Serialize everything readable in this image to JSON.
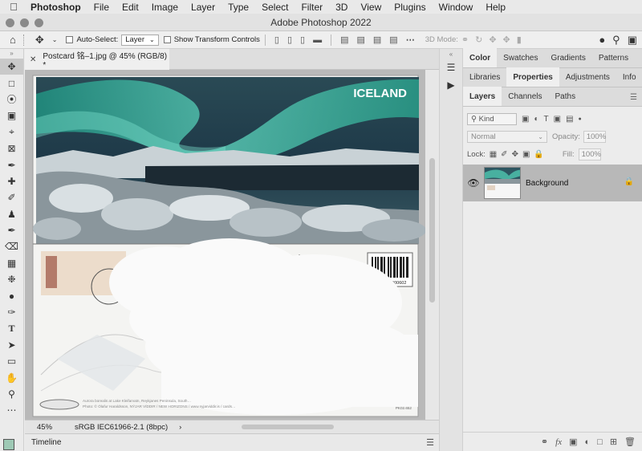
{
  "menubar": {
    "app": "Photoshop",
    "items": [
      "File",
      "Edit",
      "Image",
      "Layer",
      "Type",
      "Select",
      "Filter",
      "3D",
      "View",
      "Plugins",
      "Window",
      "Help"
    ]
  },
  "window": {
    "title": "Adobe Photoshop 2022"
  },
  "options": {
    "auto_select": "Auto-Select:",
    "layer_select": "Layer",
    "show_transform": "Show Transform Controls",
    "mode_3d": "3D Mode:"
  },
  "document": {
    "tab_title": "Postcard 铭–1.jpg @ 45% (RGB/8) *",
    "image_title": "ICELAND",
    "barcode_number": "5 690741 000602",
    "caption": "Aurora borealis at Lake Kleifarvatn, Reykjanes Peninsula, South…",
    "photo_credit": "Photo: © Ólafur Haraldsson, NÝJAR VÍDDIR / NEW HORIZONS / www.nyjarviddir.is / cards…",
    "code": "PK02.652"
  },
  "status": {
    "zoom": "45%",
    "profile": "sRGB IEC61966-2.1 (8bpc)",
    "arrow": "›"
  },
  "timeline": {
    "title": "Timeline"
  },
  "panels": {
    "row1_tabs": [
      "Color",
      "Swatches",
      "Gradients",
      "Patterns"
    ],
    "row2_tabs": [
      "Libraries",
      "Properties",
      "Adjustments",
      "Info"
    ],
    "row3_tabs": [
      "Layers",
      "Channels",
      "Paths"
    ],
    "kind": "Kind",
    "blend_mode": "Normal",
    "opacity_label": "Opacity:",
    "opacity_value": "100%",
    "lock_label": "Lock:",
    "fill_label": "Fill:",
    "fill_value": "100%",
    "layer_name": "Background"
  },
  "colors": {
    "foreground_swatch": "#9ec9b5",
    "aurora": "#3fb8a0",
    "sky": "#1e3948"
  }
}
